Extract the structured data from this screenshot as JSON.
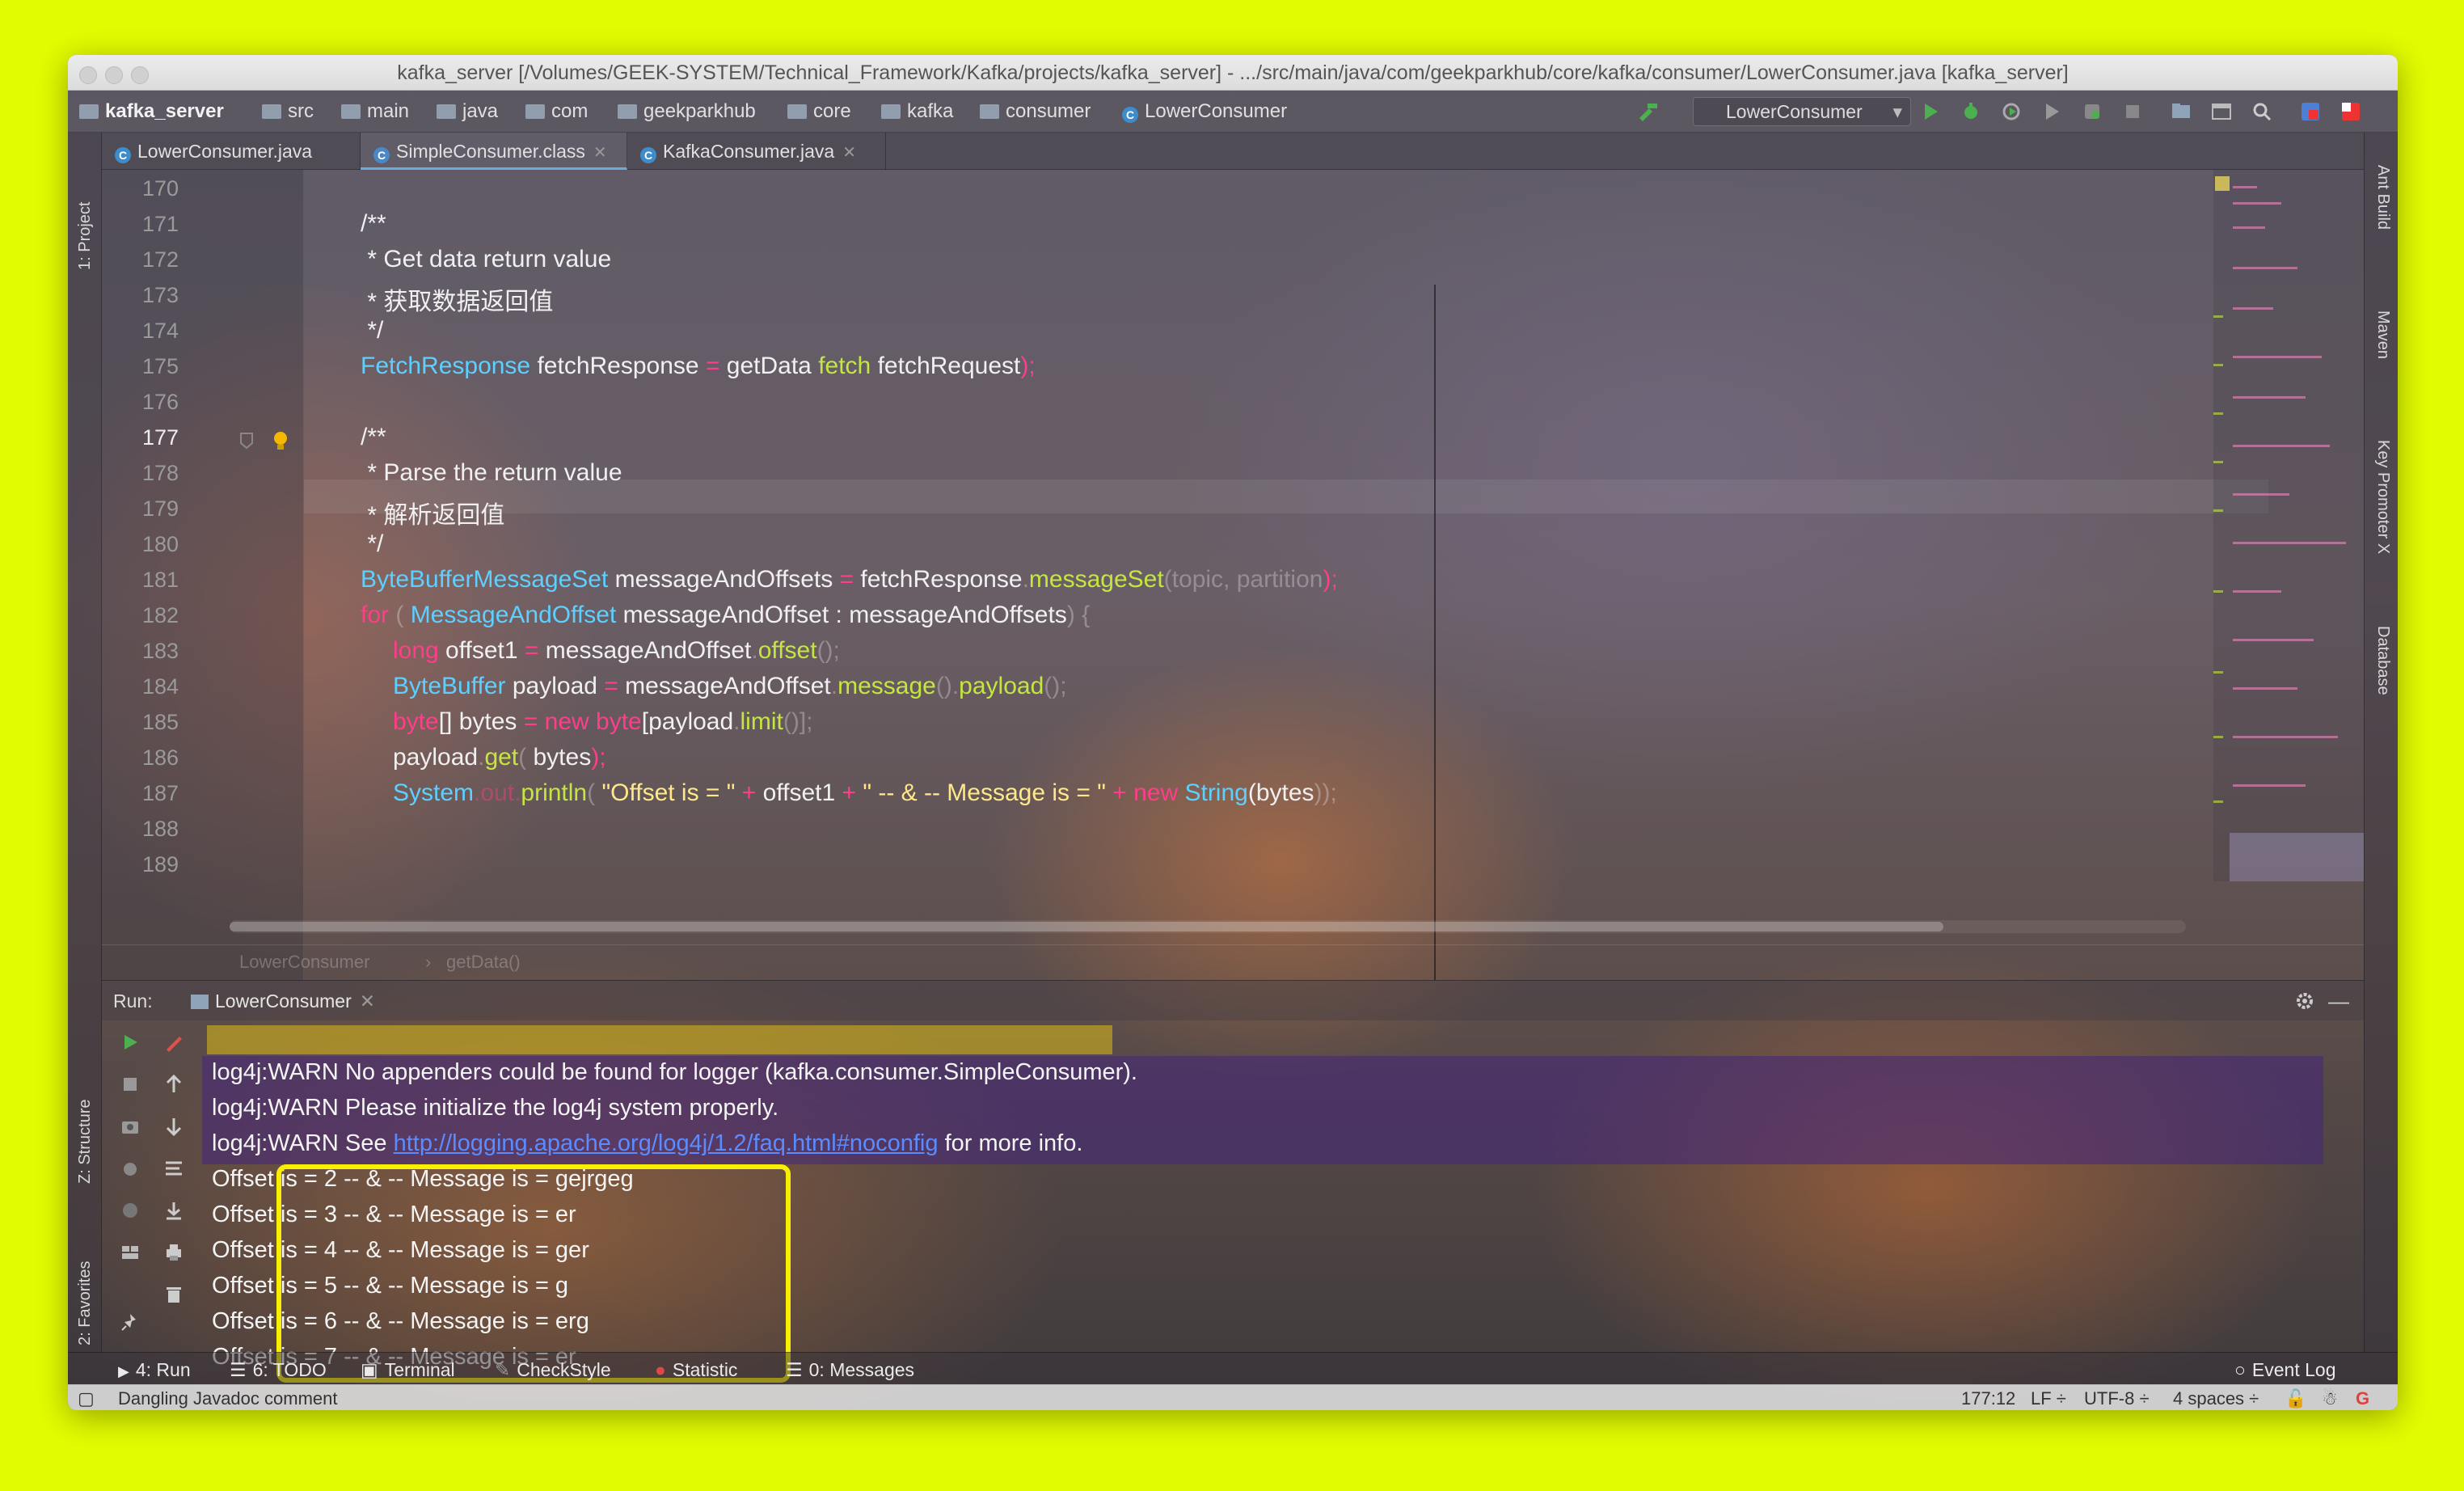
{
  "window": {
    "title": "kafka_server [/Volumes/GEEK-SYSTEM/Technical_Framework/Kafka/projects/kafka_server] - .../src/main/java/com/geekparkhub/core/kafka/consumer/LowerConsumer.java [kafka_server]"
  },
  "navbar": {
    "crumbs": [
      "kafka_server",
      "src",
      "main",
      "java",
      "com",
      "geekparkhub",
      "core",
      "kafka",
      "consumer",
      "LowerConsumer"
    ],
    "run_config": "LowerConsumer"
  },
  "left_strip": {
    "project": "1: Project",
    "structure": "Z: Structure",
    "favorites": "2: Favorites"
  },
  "right_strip": {
    "ant": "Ant Build",
    "maven": "Maven",
    "key_promoter": "Key Promoter X",
    "database": "Database"
  },
  "tabs": [
    {
      "label": "LowerConsumer.java",
      "icon": "class-icon"
    },
    {
      "label": "SimpleConsumer.class",
      "icon": "class-icon"
    },
    {
      "label": "KafkaConsumer.java",
      "icon": "class-icon"
    }
  ],
  "editor": {
    "line_numbers": [
      "170",
      "171",
      "172",
      "173",
      "174",
      "175",
      "176",
      "177",
      "178",
      "179",
      "180",
      "181",
      "182",
      "183",
      "184",
      "185",
      "186",
      "187",
      "188",
      "189"
    ],
    "current_line": "177",
    "code": {
      "l171": "/**",
      "l172": " * Get data return value",
      "l173": " * 获取数据返回值",
      "l174": " */",
      "l175_type": "FetchResponse",
      "l175_var": " fetchResponse ",
      "l175_eq": "=",
      "l175_call": " getData ",
      "l175_m": "fetch",
      "l175_rest": " fetchRequest",
      "l175_end": ");",
      "l177": "/**",
      "l178": " * Parse the return value",
      "l179": " * 解析返回值",
      "l180": " */",
      "l181_type": "ByteBufferMessageSet",
      "l181_var": " messageAndOffsets ",
      "l181_eq": "=",
      "l181_obj": " fetchResponse",
      "l181_m": "messageSet",
      "l181_args": "topic, partition",
      "l181_end": ");",
      "l182_kw": "for",
      "l182_type": "MessageAndOffset",
      "l182_rest": " messageAndOffset : messageAndOffsets",
      "l182_end": ") {",
      "l183_kw": "long",
      "l183_rest": " offset1 ",
      "l183_eq": "=",
      "l183_obj": " messageAndOffset",
      "l183_m": "offset",
      "l183_end": "();",
      "l184_type": "ByteBuffer",
      "l184_rest": " payload ",
      "l184_eq": "=",
      "l184_obj": " messageAndOffset",
      "l184_m": "message",
      "l184_m2": "payload",
      "l184_end": "();",
      "l185_kw": "byte",
      "l185_rest": "[] bytes ",
      "l185_eq": "=",
      "l185_new": " new ",
      "l185_kw2": "byte",
      "l185_obj": "[payload",
      "l185_m": "limit",
      "l185_end": "()];",
      "l186_obj": "payload",
      "l186_m": "get",
      "l186_rest": " bytes",
      "l186_end": ");",
      "l187_type": "System",
      "l187_out": ".out.",
      "l187_m": "println",
      "l187_str": " \"Offset is = \" ",
      "l187_plus": "+",
      "l187_var": " offset1 ",
      "l187_plus2": "+",
      "l187_str2": " \" -- & -- Message is = \" ",
      "l187_plus3": "+",
      "l187_new": " new ",
      "l187_type2": "String",
      "l187_args": "(bytes",
      "l187_end": "));"
    }
  },
  "breadcrumb": {
    "class": "LowerConsumer",
    "method": "getData()"
  },
  "run_panel": {
    "label": "Run:",
    "tab": "LowerConsumer",
    "console": {
      "warn1": "log4j:WARN No appenders could be found for logger (kafka.consumer.SimpleConsumer).",
      "warn2": "log4j:WARN Please initialize the log4j system properly.",
      "warn3_prefix": "log4j:WARN See ",
      "warn3_link": "http://logging.apache.org/log4j/1.2/faq.html#noconfig",
      "warn3_suffix": " for more info.",
      "outputs": [
        "Offset is = 2 -- & -- Message is = gejrgeg",
        "Offset is = 3 -- & -- Message is = er",
        "Offset is = 4 -- & -- Message is = ger",
        "Offset is = 5 -- & -- Message is = g",
        "Offset is = 6 -- & -- Message is = erg",
        "Offset is = 7 -- & -- Message is = er"
      ]
    }
  },
  "bottom_tools": {
    "run": "4: Run",
    "todo": "6: TODO",
    "terminal": "Terminal",
    "checkstyle": "CheckStyle",
    "statistic": "Statistic",
    "messages": "0: Messages",
    "event_log": "Event Log"
  },
  "status": {
    "message": "Dangling Javadoc comment",
    "position": "177:12",
    "line_sep": "LF ÷",
    "encoding": "UTF-8 ÷",
    "indent": "4 spaces ÷"
  },
  "colors": {
    "background": "#e2fc00",
    "highlight": "#f8f000",
    "keyword": "#ff3d8b",
    "type": "#5cd0ff",
    "method": "#c4e640",
    "string": "#ffe88a"
  }
}
